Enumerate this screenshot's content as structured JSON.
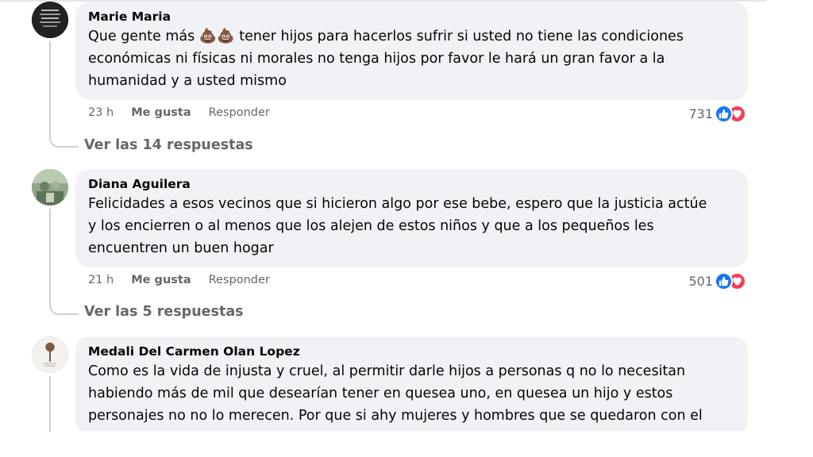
{
  "comments": [
    {
      "author": "Marie Maria",
      "text_before_emoji": "Que gente más ",
      "emoji": "💩💩",
      "text_after_emoji": " tener hijos para hacerlos sufrir si usted no tiene las condiciones",
      "text_line2": "económicas ni físicas ni morales no tenga hijos por favor le hará un gran favor a la",
      "text_line3": "humanidad y a usted mismo",
      "time": "23 h",
      "like_label": "Me gusta",
      "reply_label": "Responder",
      "reaction_count": "731",
      "view_replies": "Ver las 14 respuestas"
    },
    {
      "author": "Diana Aguilera",
      "text_line1": "Felicidades a esos vecinos que si hicieron algo por ese bebe, espero que la justicia actúe",
      "text_line2": "y los encierren o al menos que los alejen de estos niños y que a los pequeños les",
      "text_line3": "encuentren un buen hogar",
      "time": "21 h",
      "like_label": "Me gusta",
      "reply_label": "Responder",
      "reaction_count": "501",
      "view_replies": "Ver las 5 respuestas"
    },
    {
      "author": "Medali Del Carmen Olan Lopez",
      "text_line1": "Como es la vida de injusta y cruel, al permitir darle hijos a personas q no lo necesitan",
      "text_line2": "habiendo más de mil que desearían tener en quesea uno, en quesea un hijo y estos",
      "text_line3": "personajes no no lo merecen. Por que si ahy mujeres y hombres que se quedaron con el"
    }
  ],
  "icons": {
    "like": "thumbs-up-icon",
    "love": "heart-icon"
  },
  "colors": {
    "like": "#1877f2",
    "love": "#f33e58",
    "bubble": "#f0f2f5",
    "meta": "#65676b"
  }
}
